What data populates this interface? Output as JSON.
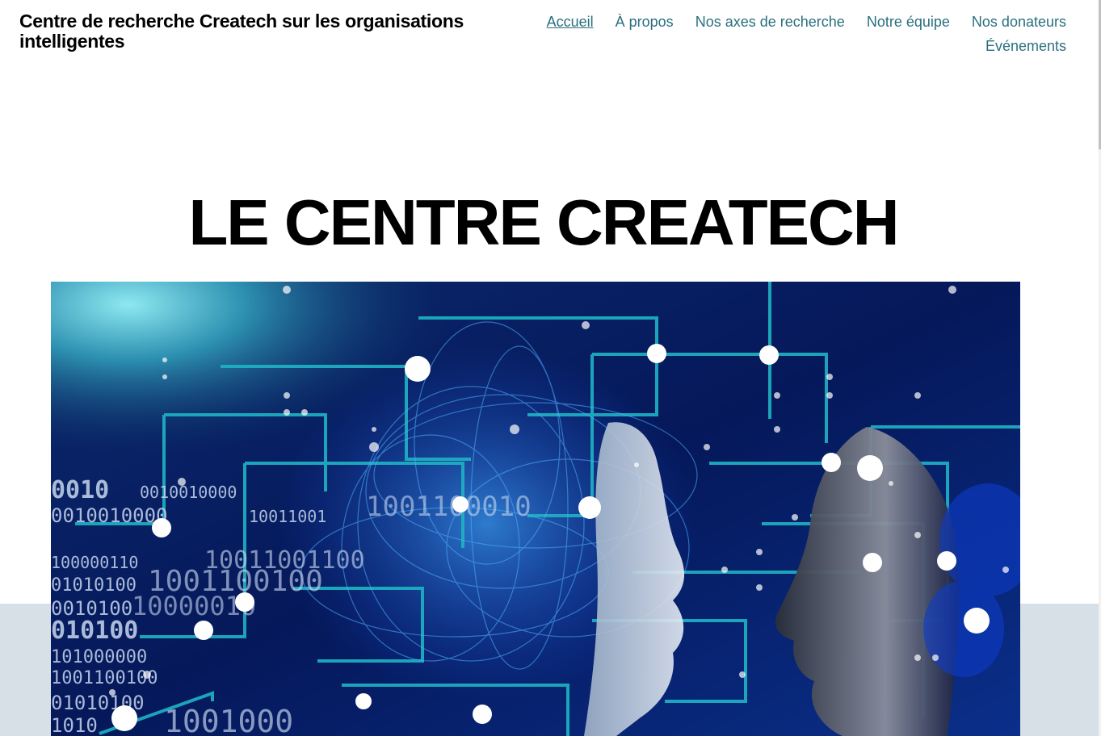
{
  "site": {
    "title": "Centre de recherche Createch sur les organisations intelligentes"
  },
  "nav": {
    "items": [
      {
        "label": "Accueil",
        "active": true
      },
      {
        "label": "À propos"
      },
      {
        "label": "Nos axes de recherche"
      },
      {
        "label": "Notre équipe"
      },
      {
        "label": "Nos donateurs"
      },
      {
        "label": "Événements"
      }
    ]
  },
  "hero": {
    "heading": "LE CENTRE CREATECH",
    "binary_lines": [
      "0010",
      "0010010000",
      "10011001",
      "1001100010",
      "100000110",
      "0010100",
      "10011001100",
      "01010100",
      "1001100100",
      "10000010",
      "010100",
      "101000000",
      "1010",
      "1001000"
    ]
  },
  "colors": {
    "nav_link": "#2a6f7f",
    "band": "#d7e0e7",
    "image_bg": "#061a55",
    "circuit": "#1fb3c4"
  }
}
